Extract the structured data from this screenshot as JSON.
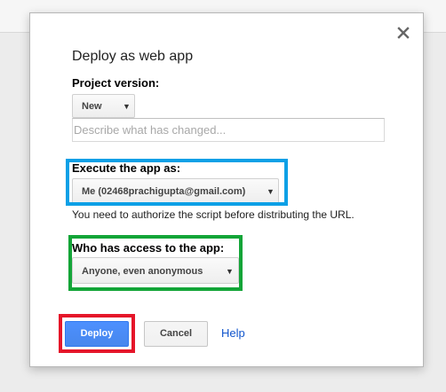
{
  "dialog": {
    "title": "Deploy as web app",
    "close_icon": "close-icon"
  },
  "project_version": {
    "label": "Project version:",
    "selected": "New",
    "description_placeholder": "Describe what has changed...",
    "description_value": ""
  },
  "execute_as": {
    "label": "Execute the app as:",
    "selected": "Me (02468prachigupta@gmail.com)",
    "note": "You need to authorize the script before distributing the URL."
  },
  "access": {
    "label": "Who has access to the app:",
    "selected": "Anyone, even anonymous"
  },
  "actions": {
    "deploy_label": "Deploy",
    "cancel_label": "Cancel",
    "help_label": "Help"
  },
  "colors": {
    "primary_button": "#4d90fe",
    "link": "#1155cc",
    "highlight_execute": "#0da0e6",
    "highlight_access": "#13a538",
    "highlight_deploy": "#e5162a"
  },
  "icons": {
    "close": "close-icon",
    "dropdown": "dropdown-arrow-icon"
  }
}
